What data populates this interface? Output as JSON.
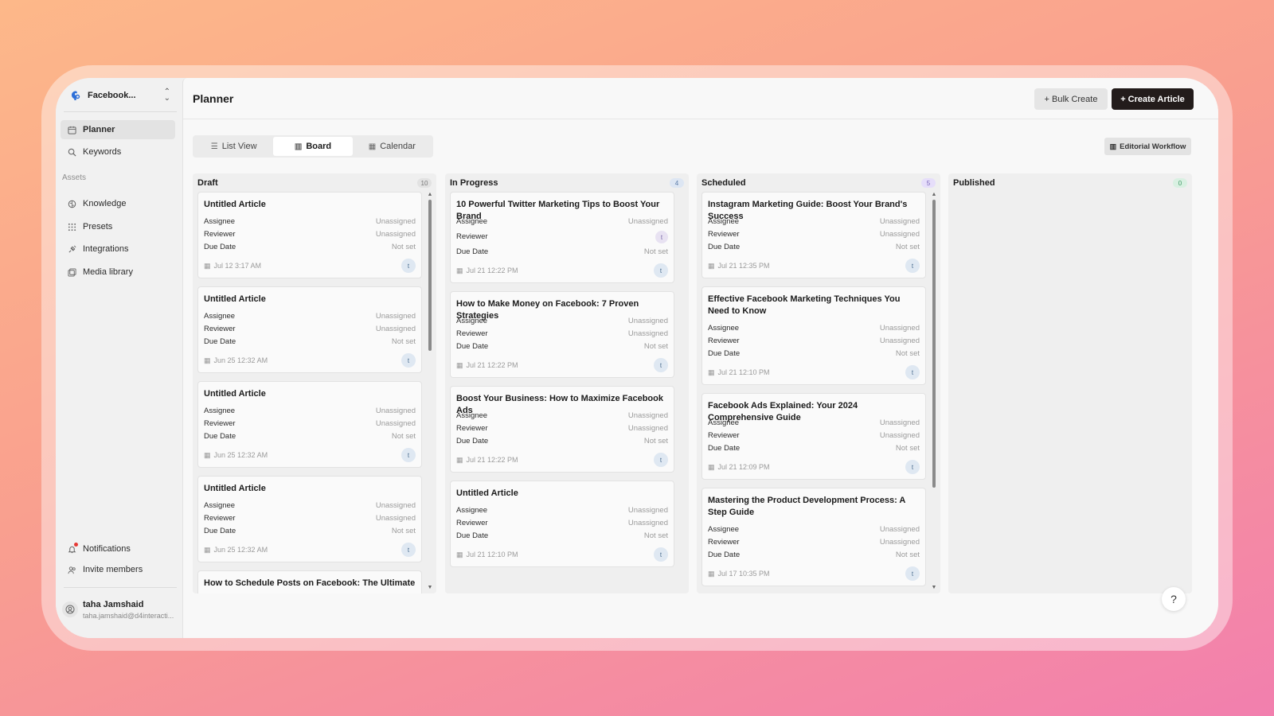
{
  "workspace": {
    "name": "Facebook..."
  },
  "sidebar": {
    "items": [
      {
        "label": "Planner",
        "icon": "calendar-icon"
      },
      {
        "label": "Keywords",
        "icon": "search-icon"
      }
    ],
    "assets_label": "Assets",
    "assets": [
      {
        "label": "Knowledge",
        "icon": "brain-icon"
      },
      {
        "label": "Presets",
        "icon": "grid-dots-icon"
      },
      {
        "label": "Integrations",
        "icon": "plug-icon"
      },
      {
        "label": "Media library",
        "icon": "images-icon"
      }
    ],
    "bottom": [
      {
        "label": "Notifications",
        "icon": "bell-icon"
      },
      {
        "label": "Invite members",
        "icon": "users-icon"
      }
    ],
    "user": {
      "name": "taha Jamshaid",
      "email": "taha.jamshaid@d4interacti..."
    }
  },
  "header": {
    "title": "Planner",
    "bulk_create": "+ Bulk Create",
    "create_article": "+ Create Article"
  },
  "view_tabs": [
    {
      "label": "List View",
      "icon": "list-icon"
    },
    {
      "label": "Board",
      "icon": "board-icon"
    },
    {
      "label": "Calendar",
      "icon": "calendar-icon"
    }
  ],
  "editorial_workflow": "Editorial Workflow",
  "labels": {
    "assignee": "Assignee",
    "reviewer": "Reviewer",
    "due_date": "Due Date"
  },
  "columns": [
    {
      "title": "Draft",
      "count": "10",
      "cards": [
        {
          "title": "Untitled Article",
          "assignee": "Unassigned",
          "reviewer": "Unassigned",
          "due": "Not set",
          "date": "Jul 12 3:17 AM",
          "avatar": "t"
        },
        {
          "title": "Untitled Article",
          "assignee": "Unassigned",
          "reviewer": "Unassigned",
          "due": "Not set",
          "date": "Jun 25 12:32 AM",
          "avatar": "t"
        },
        {
          "title": "Untitled Article",
          "assignee": "Unassigned",
          "reviewer": "Unassigned",
          "due": "Not set",
          "date": "Jun 25 12:32 AM",
          "avatar": "t"
        },
        {
          "title": "Untitled Article",
          "assignee": "Unassigned",
          "reviewer": "Unassigned",
          "due": "Not set",
          "date": "Jun 25 12:32 AM",
          "avatar": "t"
        },
        {
          "title": "How to Schedule Posts on Facebook: The Ultimate"
        }
      ]
    },
    {
      "title": "In Progress",
      "count": "4",
      "cards": [
        {
          "title": "10 Powerful Twitter Marketing Tips to Boost Your Brand",
          "assignee": "Unassigned",
          "reviewer_avatar": "t",
          "due": "Not set",
          "date": "Jul 21 12:22 PM",
          "avatar": "t"
        },
        {
          "title": "How to Make Money on Facebook: 7 Proven Strategies",
          "assignee": "Unassigned",
          "reviewer": "Unassigned",
          "due": "Not set",
          "date": "Jul 21 12:22 PM",
          "avatar": "t"
        },
        {
          "title": "Boost Your Business: How to Maximize Facebook Ads",
          "assignee": "Unassigned",
          "reviewer": "Unassigned",
          "due": "Not set",
          "date": "Jul 21 12:22 PM",
          "avatar": "t"
        },
        {
          "title": "Untitled Article",
          "assignee": "Unassigned",
          "reviewer": "Unassigned",
          "due": "Not set",
          "date": "Jul 21 12:10 PM",
          "avatar": "t"
        }
      ]
    },
    {
      "title": "Scheduled",
      "count": "5",
      "cards": [
        {
          "title": "Instagram Marketing Guide: Boost Your Brand's Success",
          "assignee": "Unassigned",
          "reviewer": "Unassigned",
          "due": "Not set",
          "date": "Jul 21 12:35 PM",
          "avatar": "t"
        },
        {
          "title": "Effective Facebook Marketing Techniques You Need to Know",
          "assignee": "Unassigned",
          "reviewer": "Unassigned",
          "due": "Not set",
          "date": "Jul 21 12:10 PM",
          "avatar": "t"
        },
        {
          "title": "Facebook Ads Explained: Your 2024 Comprehensive Guide",
          "assignee": "Unassigned",
          "reviewer": "Unassigned",
          "due": "Not set",
          "date": "Jul 21 12:09 PM",
          "avatar": "t"
        },
        {
          "title": "Mastering the Product Development Process: A Step Guide",
          "assignee": "Unassigned",
          "reviewer": "Unassigned",
          "due": "Not set",
          "date": "Jul 17 10:35 PM",
          "avatar": "t"
        }
      ]
    },
    {
      "title": "Published",
      "count": "0",
      "cards": []
    }
  ],
  "colors": {
    "draft_badge": "#e2e2e2",
    "inprogress_badge": "#dde6f3",
    "scheduled_badge": "#e6defa",
    "published_badge": "#d9f0e2",
    "primary": "#231c1b"
  },
  "help": "?"
}
